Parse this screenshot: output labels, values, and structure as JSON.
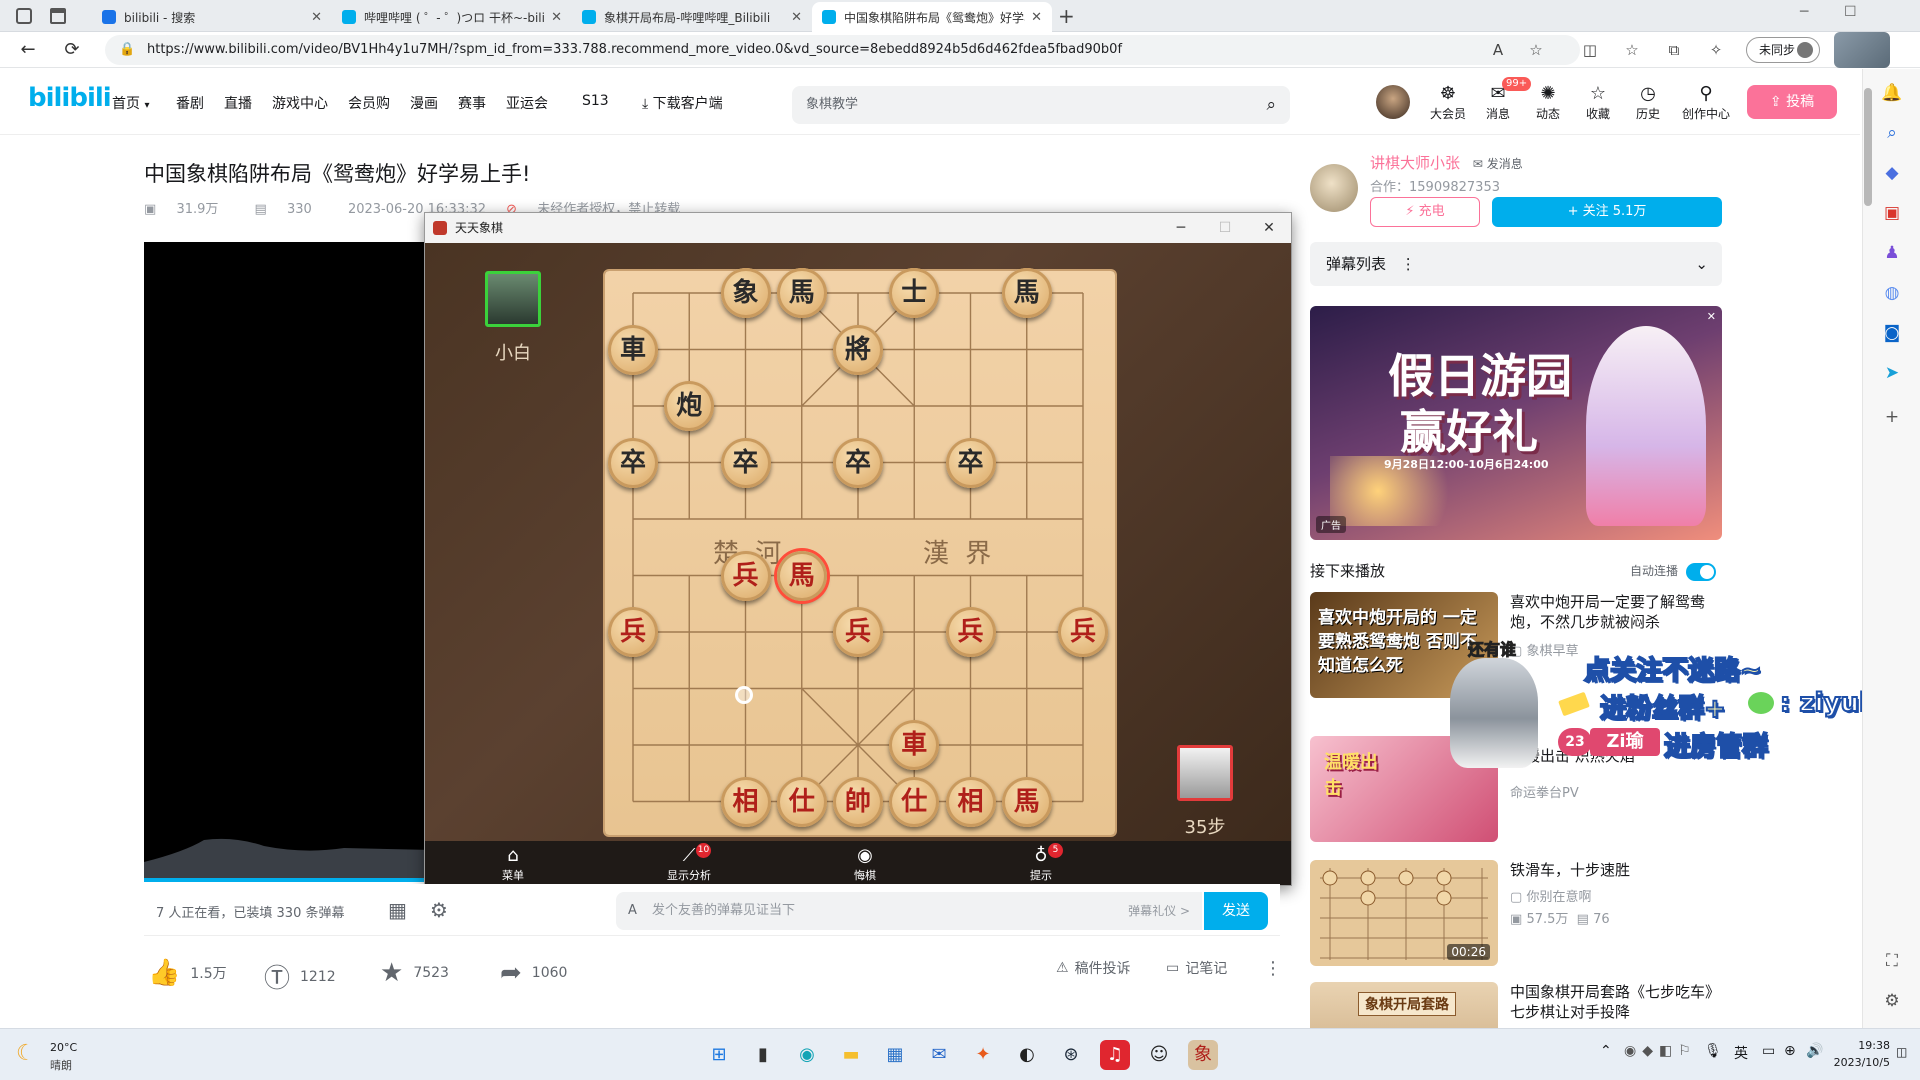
{
  "browser": {
    "tabs": [
      {
        "label": "bilibili - 搜索",
        "color": "#1a73e8"
      },
      {
        "label": "哔哩哔哩 ( ゜- ゜)つロ 干杯~-bilibili",
        "color": "#00aeec"
      },
      {
        "label": "象棋开局布局-哔哩哔哩_Bilibili",
        "color": "#00aeec"
      },
      {
        "label": "中国象棋陷阱布局《鸳鸯炮》好学易上手",
        "color": "#00aeec"
      }
    ],
    "url": "https://www.bilibili.com/video/BV1Hh4y1u7MH/?spm_id_from=333.788.recommend_more_video.0&vd_source=8ebedd8924b5d6d462fdea5fbad90b0f",
    "sync_label": "未同步"
  },
  "header": {
    "nav": [
      "首页",
      "番剧",
      "直播",
      "游戏中心",
      "会员购",
      "漫画",
      "赛事",
      "亚运会",
      "S13",
      "下载客户端"
    ],
    "search_placeholder": "象棋教学",
    "icons": [
      {
        "label": "大会员",
        "icon": "vip-icon"
      },
      {
        "label": "消息",
        "icon": "message-icon",
        "badge": "99+"
      },
      {
        "label": "动态",
        "icon": "wind-icon"
      },
      {
        "label": "收藏",
        "icon": "star-icon"
      },
      {
        "label": "历史",
        "icon": "clock-icon"
      },
      {
        "label": "创作中心",
        "icon": "bulb-icon"
      }
    ],
    "upload_label": "投稿"
  },
  "video": {
    "title": "中国象棋陷阱布局《鸳鸯炮》好学易上手!",
    "views": "31.9万",
    "danmaku_count": "330",
    "date": "2023-06-20 16:33:32",
    "notice": "未经作者授权，禁止转载",
    "watching": "7 人正在看，已装填 330 条弹幕",
    "danmaku_placeholder": "发个友善的弹幕见证当下",
    "danmaku_etiquette": "弹幕礼仪 >",
    "send_label": "发送",
    "likes": "1.5万",
    "coins": "1212",
    "favorites": "7523",
    "shares": "1060",
    "report_label": "稿件投诉",
    "note_label": "记笔记"
  },
  "chess": {
    "window_title": "天天象棋",
    "player_top": "小白",
    "steps": "35步",
    "river_left": "楚 河",
    "river_right": "漢 界",
    "buttons": [
      {
        "label": "菜单",
        "icon": "menu-icon",
        "badge": ""
      },
      {
        "label": "显示分析",
        "icon": "chart-icon",
        "badge": "10"
      },
      {
        "label": "悔棋",
        "icon": "undo-icon",
        "badge": ""
      },
      {
        "label": "提示",
        "icon": "hint-icon",
        "badge": "5"
      }
    ],
    "pieces": [
      {
        "char": "象",
        "side": "black",
        "col": 2,
        "row": 0
      },
      {
        "char": "馬",
        "side": "black",
        "col": 3,
        "row": 0
      },
      {
        "char": "士",
        "side": "black",
        "col": 5,
        "row": 0
      },
      {
        "char": "馬",
        "side": "black",
        "col": 7,
        "row": 0
      },
      {
        "char": "車",
        "side": "black",
        "col": 0,
        "row": 1
      },
      {
        "char": "將",
        "side": "black",
        "col": 4,
        "row": 1
      },
      {
        "char": "炮",
        "side": "black",
        "col": 1,
        "row": 2
      },
      {
        "char": "卒",
        "side": "black",
        "col": 0,
        "row": 3
      },
      {
        "char": "卒",
        "side": "black",
        "col": 2,
        "row": 3
      },
      {
        "char": "卒",
        "side": "black",
        "col": 4,
        "row": 3
      },
      {
        "char": "卒",
        "side": "black",
        "col": 6,
        "row": 3
      },
      {
        "char": "兵",
        "side": "red",
        "col": 2,
        "row": 5
      },
      {
        "char": "馬",
        "side": "red",
        "col": 3,
        "row": 5,
        "selected": true
      },
      {
        "char": "兵",
        "side": "red",
        "col": 0,
        "row": 6
      },
      {
        "char": "兵",
        "side": "red",
        "col": 4,
        "row": 6
      },
      {
        "char": "兵",
        "side": "red",
        "col": 6,
        "row": 6
      },
      {
        "char": "兵",
        "side": "red",
        "col": 8,
        "row": 6
      },
      {
        "char": "車",
        "side": "red",
        "col": 5,
        "row": 8
      },
      {
        "char": "相",
        "side": "red",
        "col": 2,
        "row": 9
      },
      {
        "char": "仕",
        "side": "red",
        "col": 3,
        "row": 9
      },
      {
        "char": "帥",
        "side": "red",
        "col": 4,
        "row": 9
      },
      {
        "char": "仕",
        "side": "red",
        "col": 5,
        "row": 9
      },
      {
        "char": "相",
        "side": "red",
        "col": 6,
        "row": 9
      },
      {
        "char": "馬",
        "side": "red",
        "col": 7,
        "row": 9
      }
    ]
  },
  "sidebar": {
    "up_name": "讲棋大师小张",
    "message_label": "发消息",
    "up_desc": "合作：15909827353",
    "charge_label": "充电",
    "follow_label": "+ 关注 5.1万",
    "danmaku_list_label": "弹幕列表",
    "ad_text_1": "假日游园",
    "ad_text_2": "赢好礼",
    "ad_date": "9月28日12:00-10月6日24:00",
    "ad_tag": "广告",
    "up_next_label": "接下来播放",
    "autoplay_label": "自动连播",
    "videos": [
      {
        "title": "喜欢中炮开局一定要了解鸳鸯炮，不然几步就被闷杀",
        "author": "象棋早草",
        "stats": "",
        "duration": "",
        "thumb_text": "喜欢中炮开局的 一定要熟悉鸳鸯炮 否则不知道怎么死"
      },
      {
        "title": "温暖出击 炽热火焰",
        "author": "命运拳台PV",
        "stats": "",
        "duration": "",
        "thumb_text": "温暖出击"
      },
      {
        "title": "铁滑车，十步速胜",
        "author": "你别在意啊",
        "stats": "57.5万",
        "stats2": "76",
        "duration": "00:26",
        "thumb_text": ""
      },
      {
        "title": "中国象棋开局套路《七步吃车》七步棋让对手投降",
        "author": "",
        "stats": "",
        "duration": "",
        "thumb_text": "象棋开局套路"
      }
    ]
  },
  "overlay": {
    "line1": "点关注不迷路~",
    "line2": "进粉丝群+",
    "wechat_id": ": ziyuiiii",
    "line3_name": "Zi瑜",
    "line3": "进房管群",
    "whisper": "还有谁",
    "badge_num": "23"
  },
  "taskbar": {
    "weather_temp": "20°C",
    "weather_desc": "晴朗",
    "ime": "英",
    "time": "19:38",
    "date": "2023/10/5"
  }
}
